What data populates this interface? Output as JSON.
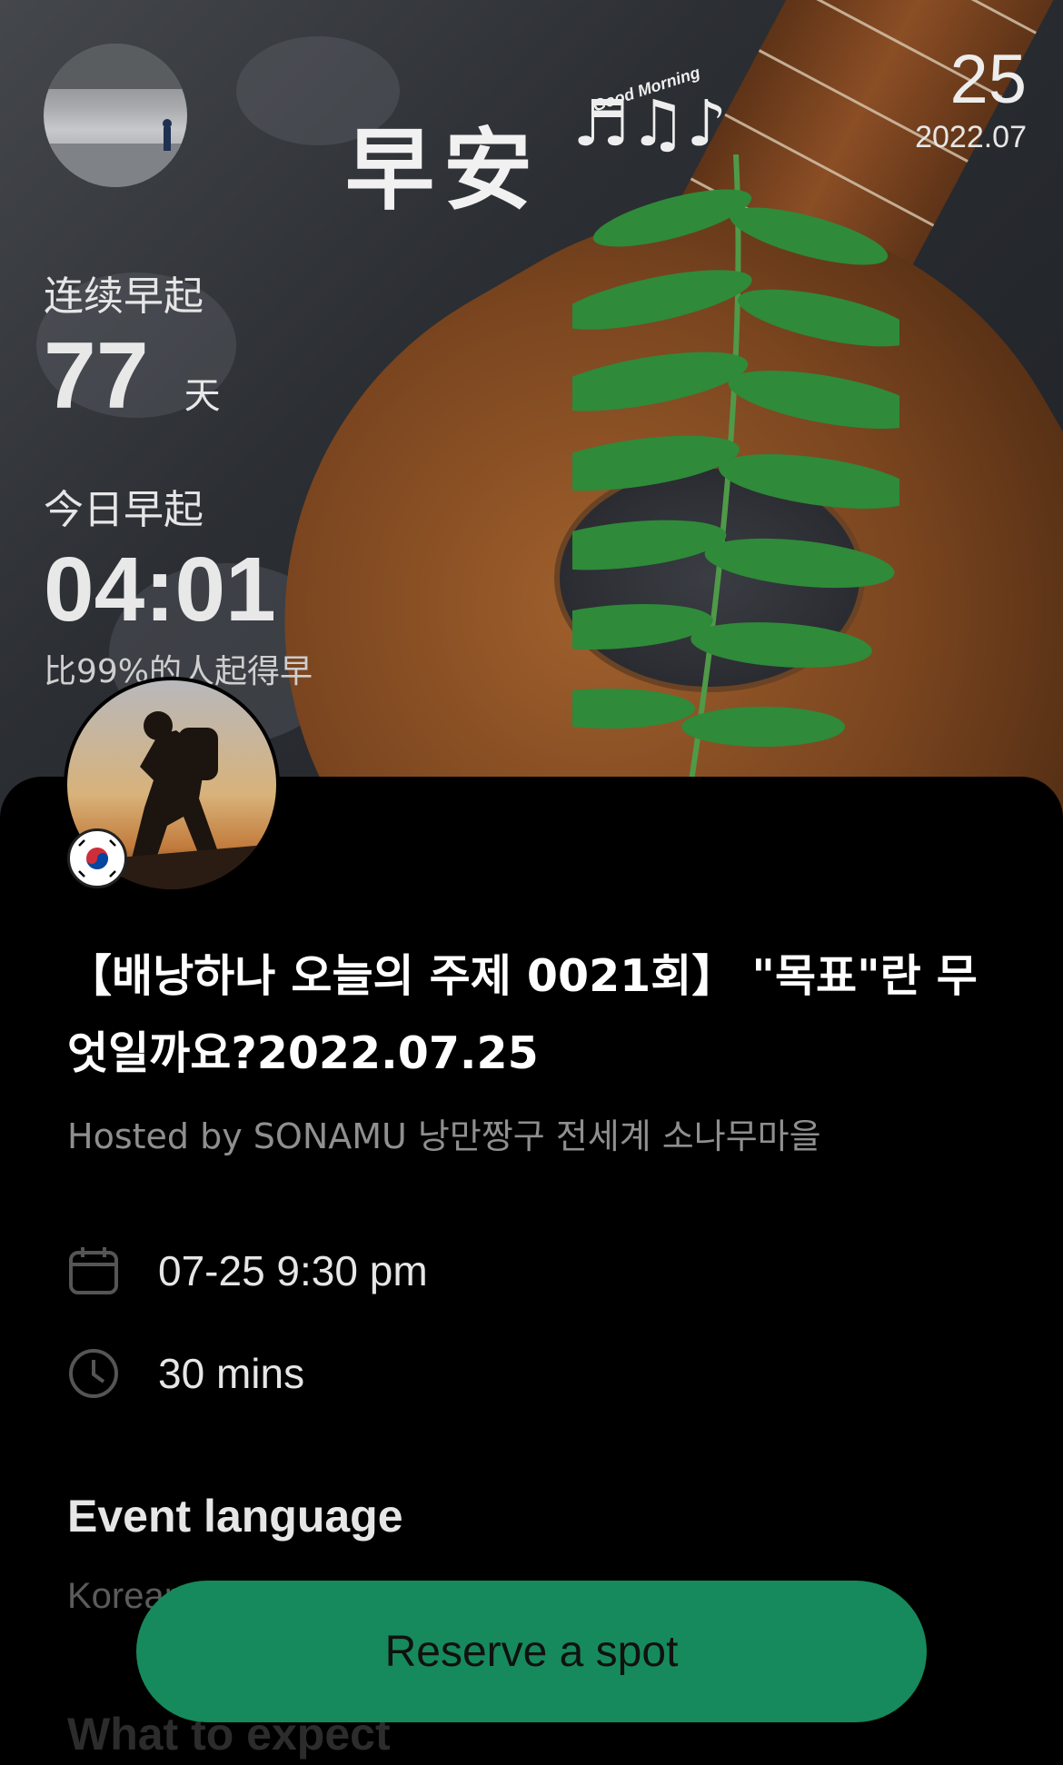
{
  "hero": {
    "greeting": "早安",
    "greeting_tag": "Good Morning",
    "notes": "♬♫♪",
    "day": "25",
    "year_month": "2022.07",
    "streak_label": "连续早起",
    "streak_value": "77",
    "streak_unit": "天",
    "today_label": "今日早起",
    "today_time": "04:01",
    "rank_text": "比99%的人起得早"
  },
  "event": {
    "title": "【배낭하나 오늘의 주제 0021회】 \"목표\"란 무엇일까요?2022.07.25",
    "host_line": "Hosted by SONAMU 낭만짱구 전세계 소나무마을",
    "datetime": "07-25 9:30 pm",
    "duration": "30 mins",
    "language_heading": "Event language",
    "language_value": "Korean",
    "expect_heading": "What to expect",
    "flag_icon": "south-korea-flag-icon"
  },
  "actions": {
    "reserve_label": "Reserve a spot"
  },
  "colors": {
    "accent": "#168a5c",
    "background": "#000000",
    "muted_text": "#8f8f8f"
  }
}
